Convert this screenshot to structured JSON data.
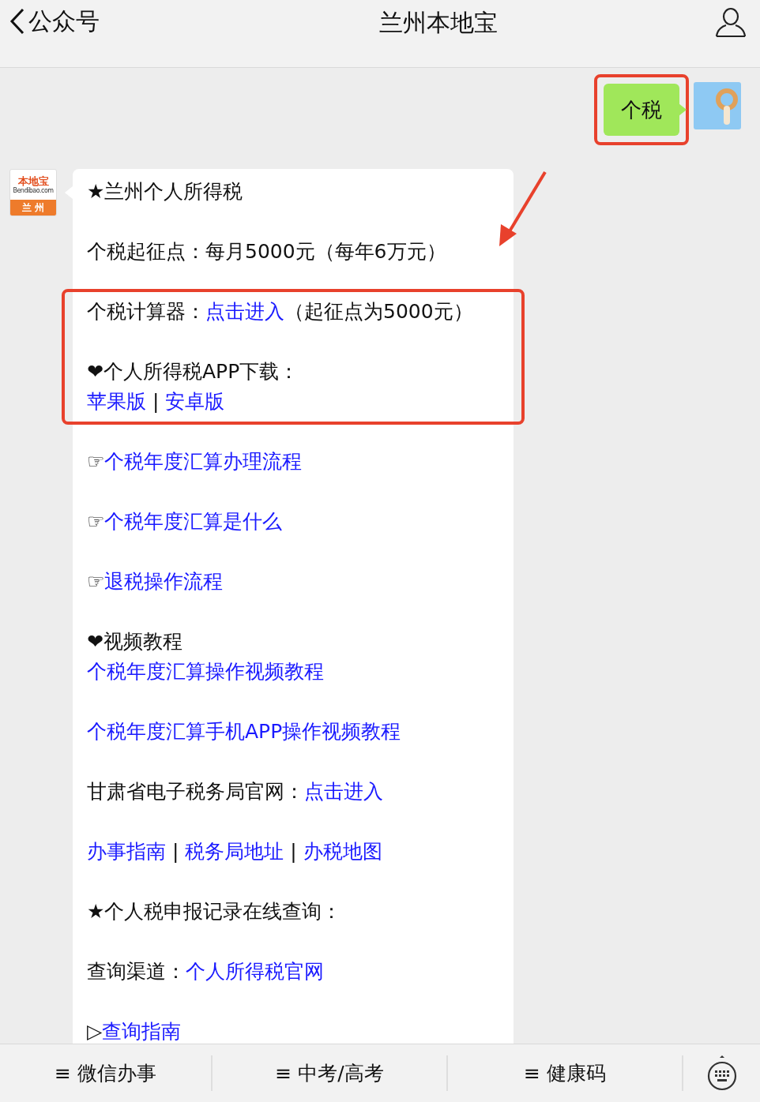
{
  "header": {
    "back": "公众号",
    "title": "兰州本地宝"
  },
  "sent": {
    "text": "个税",
    "highlighted": true
  },
  "received": {
    "avatar": {
      "top": "本地宝",
      "site": "Bendibao.com",
      "city": "兰 州"
    },
    "arrow": true,
    "blocks": [
      {
        "highlighted": false,
        "lines": [
          [
            {
              "kind": "text",
              "text": "★兰州个人所得税"
            }
          ]
        ]
      },
      {
        "highlighted": false,
        "lines": [
          [
            {
              "kind": "text",
              "text": "个税起征点：每月5000元（每年6万元）"
            }
          ]
        ]
      },
      {
        "highlighted": true,
        "lines": [
          [
            {
              "kind": "text",
              "text": "个税计算器："
            },
            {
              "kind": "link",
              "text": "点击进入"
            },
            {
              "kind": "text",
              "text": "（起征点为5000元）"
            }
          ]
        ]
      },
      {
        "highlighted": true,
        "lines": [
          [
            {
              "kind": "text",
              "text": "❤个人所得税APP下载："
            }
          ],
          [
            {
              "kind": "link",
              "text": "苹果版"
            },
            {
              "kind": "text",
              "text": " | "
            },
            {
              "kind": "link",
              "text": "安卓版"
            }
          ]
        ]
      },
      {
        "highlighted": false,
        "lines": [
          [
            {
              "kind": "text",
              "text": "☞"
            },
            {
              "kind": "link",
              "text": "个税年度汇算办理流程"
            }
          ]
        ]
      },
      {
        "highlighted": false,
        "lines": [
          [
            {
              "kind": "text",
              "text": "☞"
            },
            {
              "kind": "link",
              "text": "个税年度汇算是什么"
            }
          ]
        ]
      },
      {
        "highlighted": false,
        "lines": [
          [
            {
              "kind": "text",
              "text": "☞"
            },
            {
              "kind": "link",
              "text": "退税操作流程"
            }
          ]
        ]
      },
      {
        "highlighted": false,
        "lines": [
          [
            {
              "kind": "text",
              "text": "❤视频教程"
            }
          ],
          [
            {
              "kind": "link",
              "text": "个税年度汇算操作视频教程"
            }
          ]
        ]
      },
      {
        "highlighted": false,
        "lines": [
          [
            {
              "kind": "link",
              "text": "个税年度汇算手机APP操作视频教程"
            }
          ]
        ]
      },
      {
        "highlighted": false,
        "lines": [
          [
            {
              "kind": "text",
              "text": "甘肃省电子税务局官网："
            },
            {
              "kind": "link",
              "text": "点击进入"
            }
          ]
        ]
      },
      {
        "highlighted": false,
        "lines": [
          [
            {
              "kind": "link",
              "text": "办事指南"
            },
            {
              "kind": "text",
              "text": " | "
            },
            {
              "kind": "link",
              "text": "税务局地址"
            },
            {
              "kind": "text",
              "text": " | "
            },
            {
              "kind": "link",
              "text": "办税地图"
            }
          ]
        ]
      },
      {
        "highlighted": false,
        "lines": [
          [
            {
              "kind": "text",
              "text": "★个人税申报记录在线查询："
            }
          ]
        ]
      },
      {
        "highlighted": false,
        "lines": [
          [
            {
              "kind": "text",
              "text": "查询渠道："
            },
            {
              "kind": "link",
              "text": "个人所得税官网"
            }
          ]
        ]
      },
      {
        "highlighted": false,
        "lines": [
          [
            {
              "kind": "text",
              "text": "▷"
            },
            {
              "kind": "link",
              "text": "查询指南"
            }
          ]
        ]
      }
    ]
  },
  "menu": [
    {
      "icon": "≡",
      "label": "微信办事"
    },
    {
      "icon": "≡",
      "label": "中考/高考"
    },
    {
      "icon": "≡",
      "label": "健康码"
    }
  ]
}
